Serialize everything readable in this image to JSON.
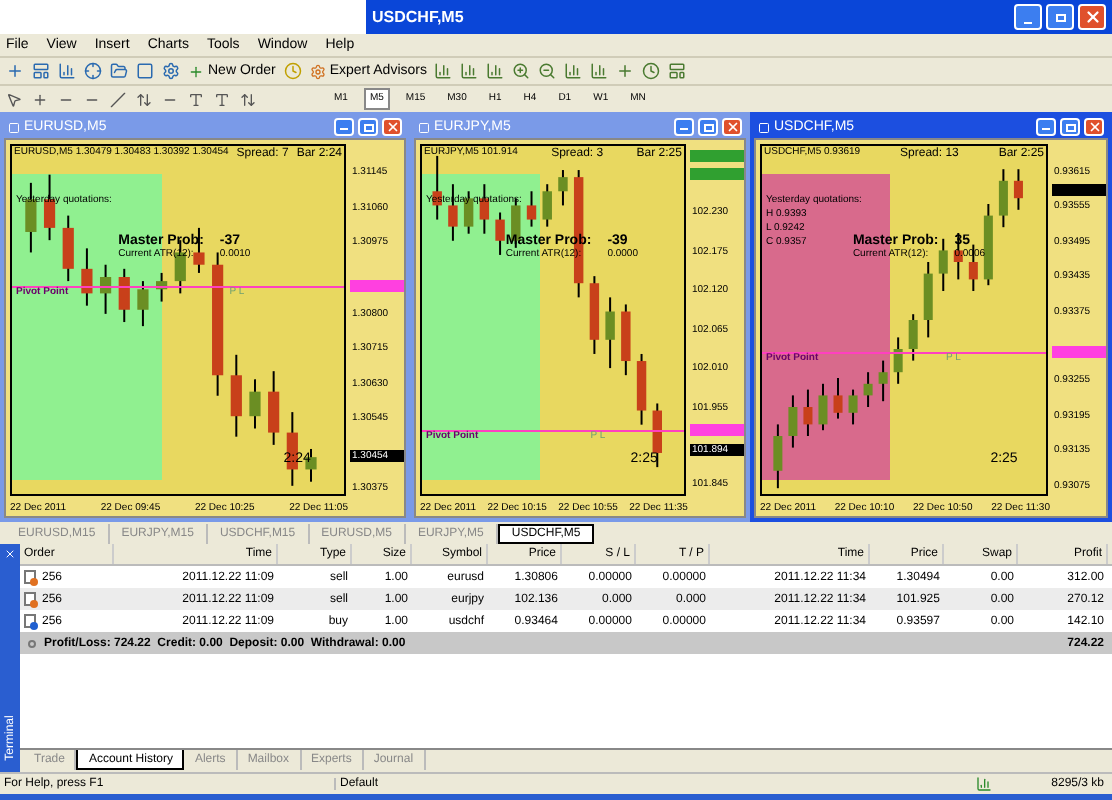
{
  "app": {
    "title": "USDCHF,M5"
  },
  "menu": [
    "File",
    "View",
    "Insert",
    "Charts",
    "Tools",
    "Window",
    "Help"
  ],
  "toolbar": {
    "buttons": [
      "New Order",
      "Expert Advisors"
    ]
  },
  "timeframes": [
    {
      "label": "M1",
      "selected": false
    },
    {
      "label": "M5",
      "selected": true
    },
    {
      "label": "M15",
      "selected": false
    },
    {
      "label": "M30",
      "selected": false
    },
    {
      "label": "H1",
      "selected": false
    },
    {
      "label": "H4",
      "selected": false
    },
    {
      "label": "D1",
      "selected": false
    },
    {
      "label": "W1",
      "selected": false
    },
    {
      "label": "MN",
      "selected": false
    }
  ],
  "charts": [
    {
      "title": "EURUSD,M5",
      "selected": false,
      "zone": {
        "color": "#90f090"
      },
      "chart_data": {
        "type": "candlestick",
        "ylim": [
          1.3036,
          1.3121
        ],
        "ref_lines": [
          {
            "axis": "y",
            "value": 1.3087
          }
        ],
        "categories": [
          null,
          null,
          null,
          null,
          null,
          null,
          null,
          null,
          null,
          null,
          null,
          null,
          null,
          null,
          null,
          null
        ],
        "yticks": [
          {
            "value": 1.31145,
            "label": "1.31145"
          },
          {
            "value": 1.3106,
            "label": "1.31060"
          },
          {
            "value": 1.30975,
            "label": "1.30975"
          },
          {
            "value": 1.308,
            "label": "1.30800"
          },
          {
            "value": 1.30715,
            "label": "1.30715"
          },
          {
            "value": 1.3063,
            "label": "1.30630"
          },
          {
            "value": 1.30545,
            "label": "1.30545"
          },
          {
            "value": 1.30375,
            "label": "1.30375"
          }
        ],
        "ohlc": [
          [
            1.31,
            1.3112,
            1.3095,
            1.3108
          ],
          [
            1.3108,
            1.3114,
            1.3098,
            1.3101
          ],
          [
            1.3101,
            1.3104,
            1.3088,
            1.3091
          ],
          [
            1.3091,
            1.3096,
            1.3082,
            1.3085
          ],
          [
            1.3085,
            1.3092,
            1.308,
            1.3089
          ],
          [
            1.3089,
            1.3091,
            1.3078,
            1.3081
          ],
          [
            1.3081,
            1.3088,
            1.3077,
            1.3086
          ],
          [
            1.3086,
            1.309,
            1.3083,
            1.3088
          ],
          [
            1.3088,
            1.3098,
            1.3085,
            1.3095
          ],
          [
            1.3095,
            1.3101,
            1.309,
            1.3092
          ],
          [
            1.3092,
            1.3095,
            1.306,
            1.3065
          ],
          [
            1.3065,
            1.307,
            1.305,
            1.3055
          ],
          [
            1.3055,
            1.3064,
            1.3052,
            1.3061
          ],
          [
            1.3061,
            1.3066,
            1.3048,
            1.3051
          ],
          [
            1.3051,
            1.3056,
            1.3038,
            1.3042
          ],
          [
            1.3042,
            1.3047,
            1.3039,
            1.3045
          ]
        ]
      },
      "ohlc": "EURUSD,M5 1.30479 1.30483 1.30392 1.30454",
      "spread": "Spread: 7",
      "bar": "Bar 2:24",
      "yesterday": [
        "Yesterday quotations:"
      ],
      "master_label": "Master Prob:",
      "master_value": "-37",
      "atr_label": "Current ATR(12):",
      "atr_value": "0.0010",
      "pivot_label": "Pivot Point",
      "pl_label": "P L",
      "timer": "2:24",
      "markers": [
        {
          "kind": "pivot"
        },
        {
          "kind": "current",
          "text": "1.30454"
        }
      ],
      "times": [
        "22 Dec 2011",
        "22 Dec 09:45",
        "22 Dec 10:25",
        "22 Dec 11:05"
      ]
    },
    {
      "title": "EURJPY,M5",
      "selected": false,
      "zone": {
        "color": "#90f090"
      },
      "chart_data": {
        "type": "candlestick",
        "ylim": [
          101.832,
          102.324
        ],
        "ref_lines": [
          {
            "axis": "y",
            "value": 101.922
          }
        ],
        "categories": [
          null,
          null,
          null,
          null,
          null,
          null,
          null,
          null,
          null,
          null,
          null,
          null,
          null,
          null,
          null
        ],
        "yticks": [
          {
            "value": 102.23,
            "label": "102.230"
          },
          {
            "value": 102.175,
            "label": "102.175"
          },
          {
            "value": 102.12,
            "label": "102.120"
          },
          {
            "value": 102.065,
            "label": "102.065"
          },
          {
            "value": 102.01,
            "label": "102.010"
          },
          {
            "value": 101.955,
            "label": "101.955"
          },
          {
            "value": 101.845,
            "label": "101.845"
          }
        ],
        "ohlc": [
          [
            102.26,
            102.31,
            102.22,
            102.24
          ],
          [
            102.24,
            102.27,
            102.19,
            102.21
          ],
          [
            102.21,
            102.26,
            102.2,
            102.25
          ],
          [
            102.25,
            102.27,
            102.2,
            102.22
          ],
          [
            102.22,
            102.23,
            102.17,
            102.19
          ],
          [
            102.19,
            102.25,
            102.18,
            102.24
          ],
          [
            102.24,
            102.26,
            102.21,
            102.22
          ],
          [
            102.22,
            102.27,
            102.21,
            102.26
          ],
          [
            102.26,
            102.29,
            102.24,
            102.28
          ],
          [
            102.28,
            102.29,
            102.11,
            102.13
          ],
          [
            102.13,
            102.14,
            102.03,
            102.05
          ],
          [
            102.05,
            102.11,
            102.01,
            102.09
          ],
          [
            102.09,
            102.1,
            102.0,
            102.02
          ],
          [
            102.02,
            102.03,
            101.93,
            101.95
          ],
          [
            101.95,
            101.96,
            101.87,
            101.89
          ]
        ]
      },
      "ohlc": "EURJPY,M5 101.914",
      "spread": "Spread: 3",
      "bar": "Bar 2:25",
      "yesterday": [
        "Yesterday quotations:"
      ],
      "master_label": "Master Prob:",
      "master_value": "-39",
      "atr_label": "Current ATR(12):",
      "atr_value": "0.0000",
      "pivot_label": "Pivot Point",
      "pl_label": "P L",
      "timer": "2:25",
      "markers": [
        {
          "kind": "level"
        },
        {
          "kind": "level"
        },
        {
          "kind": "pivot"
        },
        {
          "kind": "current",
          "text": "101.894"
        }
      ],
      "times": [
        "22 Dec 2011",
        "22 Dec 10:15",
        "22 Dec 10:55",
        "22 Dec 11:35"
      ]
    },
    {
      "title": "USDCHF,M5",
      "selected": true,
      "zone": {
        "color": "#d86a8c"
      },
      "chart_data": {
        "type": "candlestick",
        "ylim": [
          0.9306,
          0.9366
        ],
        "ref_lines": [
          {
            "axis": "y",
            "value": 0.93306
          }
        ],
        "categories": [
          null,
          null,
          null,
          null,
          null,
          null,
          null,
          null,
          null,
          null,
          null,
          null,
          null,
          null,
          null,
          null,
          null
        ],
        "yticks": [
          {
            "value": 0.93615,
            "label": "0.93615"
          },
          {
            "value": 0.93555,
            "label": "0.93555"
          },
          {
            "value": 0.93495,
            "label": "0.93495"
          },
          {
            "value": 0.93435,
            "label": "0.93435"
          },
          {
            "value": 0.93375,
            "label": "0.93375"
          },
          {
            "value": 0.93255,
            "label": "0.93255"
          },
          {
            "value": 0.93195,
            "label": "0.93195"
          },
          {
            "value": 0.93135,
            "label": "0.93135"
          },
          {
            "value": 0.93075,
            "label": "0.93075"
          }
        ],
        "ohlc": [
          [
            0.931,
            0.9318,
            0.9307,
            0.9316
          ],
          [
            0.9316,
            0.9323,
            0.9314,
            0.9321
          ],
          [
            0.9321,
            0.9324,
            0.9316,
            0.9318
          ],
          [
            0.9318,
            0.9325,
            0.9317,
            0.9323
          ],
          [
            0.9323,
            0.9326,
            0.9319,
            0.932
          ],
          [
            0.932,
            0.9324,
            0.9318,
            0.9323
          ],
          [
            0.9323,
            0.9327,
            0.9321,
            0.9325
          ],
          [
            0.9325,
            0.9329,
            0.9322,
            0.9327
          ],
          [
            0.9327,
            0.9333,
            0.9325,
            0.9331
          ],
          [
            0.9331,
            0.9337,
            0.9329,
            0.9336
          ],
          [
            0.9336,
            0.9346,
            0.9333,
            0.9344
          ],
          [
            0.9344,
            0.935,
            0.9341,
            0.9348
          ],
          [
            0.9348,
            0.9351,
            0.9343,
            0.9346
          ],
          [
            0.9346,
            0.9349,
            0.9341,
            0.9343
          ],
          [
            0.9343,
            0.9356,
            0.9342,
            0.9354
          ],
          [
            0.9354,
            0.9362,
            0.9352,
            0.936
          ],
          [
            0.936,
            0.9362,
            0.9355,
            0.9357
          ]
        ]
      },
      "ohlc": "USDCHF,M5 0.93619",
      "spread": "Spread: 13",
      "bar": "Bar 2:25",
      "yesterday": [
        "Yesterday quotations:",
        "H 0.9393",
        "L 0.9242",
        "C 0.9357"
      ],
      "master_label": "Master Prob:",
      "master_value": "35",
      "atr_label": "Current ATR(12):",
      "atr_value": "0.0006",
      "pivot_label": "Pivot Point",
      "pl_label": "P L",
      "timer": "2:25",
      "markers": [
        {
          "kind": "current"
        },
        {
          "kind": "pivot"
        }
      ],
      "times": [
        "22 Dec 2011",
        "22 Dec 10:10",
        "22 Dec 10:50",
        "22 Dec 11:30"
      ]
    }
  ],
  "chart_tabs": [
    {
      "label": "EURUSD,M15",
      "selected": false
    },
    {
      "label": "EURJPY,M15",
      "selected": false
    },
    {
      "label": "USDCHF,M15",
      "selected": false
    },
    {
      "label": "EURUSD,M5",
      "selected": false
    },
    {
      "label": "EURJPY,M5",
      "selected": false
    },
    {
      "label": "USDCHF,M5",
      "selected": true
    }
  ],
  "terminal": {
    "label": "Terminal"
  },
  "table": {
    "columns": [
      "Order",
      "Time",
      "Type",
      "Size",
      "Symbol",
      "Price",
      "S / L",
      "T / P",
      "Time",
      "Price",
      "Swap",
      "Profit"
    ],
    "rows": [
      {
        "selected": false,
        "color": "#e07020",
        "cells": [
          "256",
          "2011.12.22 11:09",
          "sell",
          "1.00",
          "eurusd",
          "1.30806",
          "0.00000",
          "0.00000",
          "2011.12.22 11:34",
          "1.30494",
          "0.00",
          "312.00"
        ]
      },
      {
        "selected": true,
        "color": "#e07020",
        "cells": [
          "256",
          "2011.12.22 11:09",
          "sell",
          "1.00",
          "eurjpy",
          "102.136",
          "0.000",
          "0.000",
          "2011.12.22 11:34",
          "101.925",
          "0.00",
          "270.12"
        ]
      },
      {
        "selected": false,
        "color": "#2060d0",
        "cells": [
          "256",
          "2011.12.22 11:09",
          "buy",
          "1.00",
          "usdchf",
          "0.93464",
          "0.00000",
          "0.00000",
          "2011.12.22 11:34",
          "0.93597",
          "0.00",
          "142.10"
        ]
      }
    ],
    "summary": {
      "text": "Profit/Loss: 724.22  Credit: 0.00  Deposit: 0.00  Withdrawal: 0.00",
      "total": "724.22"
    }
  },
  "bottom_tabs": [
    {
      "label": "Trade",
      "selected": false
    },
    {
      "label": "Account History",
      "selected": true
    },
    {
      "label": "Alerts",
      "selected": false
    },
    {
      "label": "Mailbox",
      "selected": false
    },
    {
      "label": "Experts",
      "selected": false
    },
    {
      "label": "Journal",
      "selected": false
    }
  ],
  "status_bar": [
    "For Help, press F1",
    "Default",
    "8295/3 kb"
  ]
}
